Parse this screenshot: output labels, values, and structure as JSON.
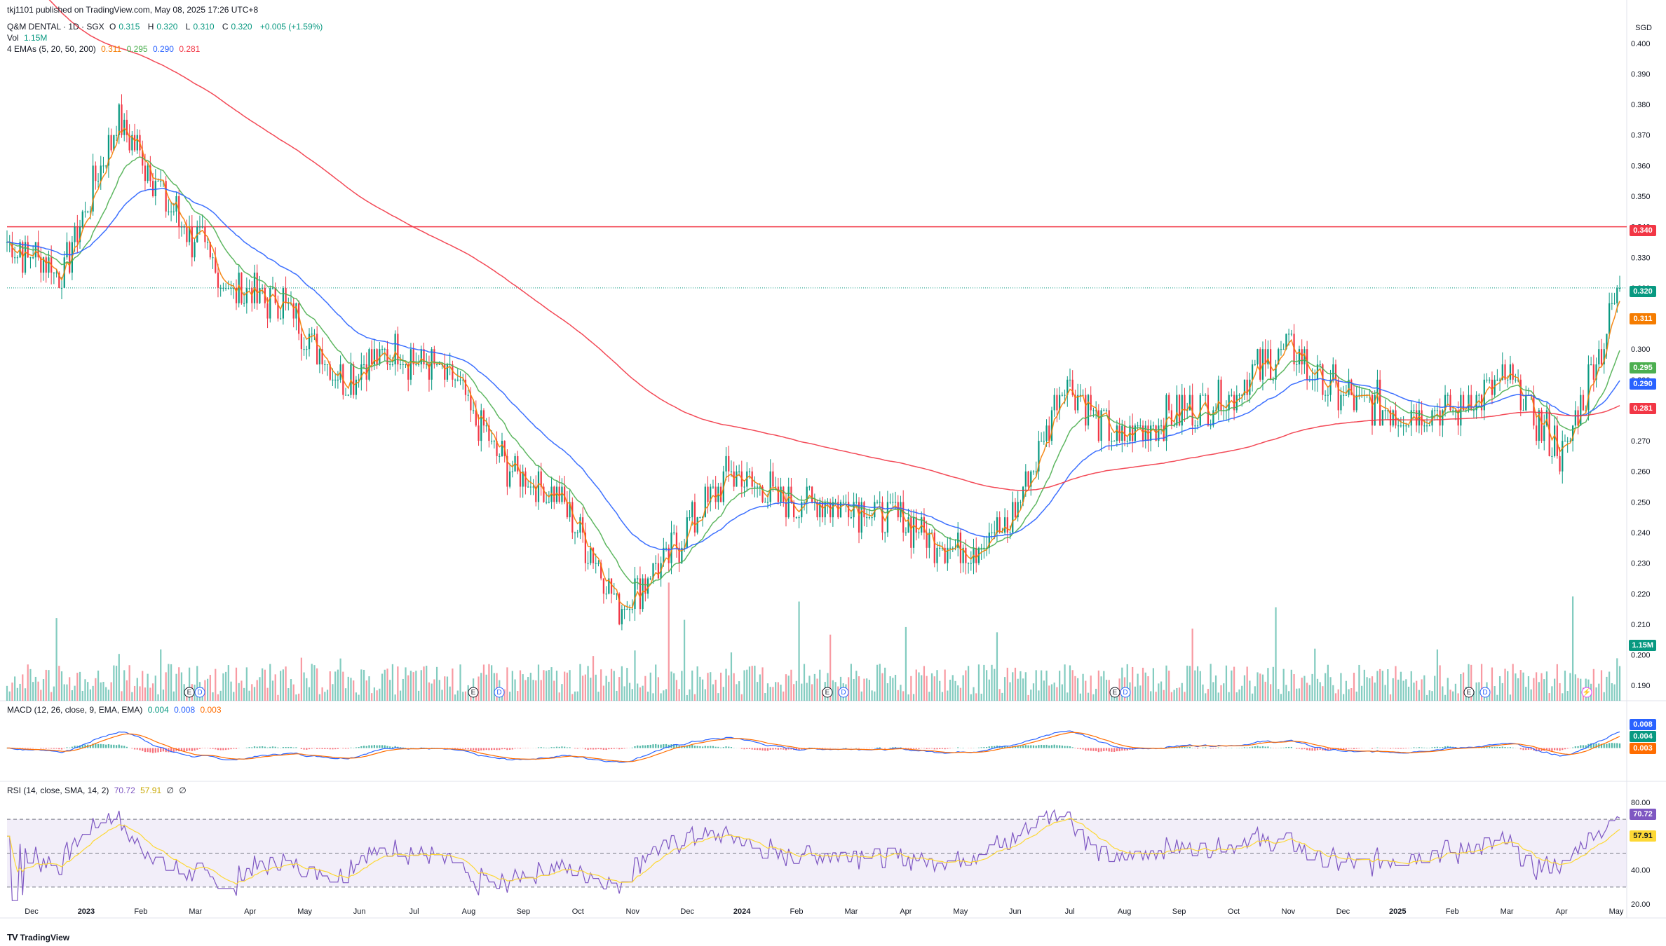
{
  "header": {
    "published": "tkj1101 published on TradingView.com, May 08, 2025 17:26 UTC+8",
    "symbol": "Q&M DENTAL · 1D · SGX",
    "ohlc": {
      "o_label": "O",
      "o": "0.315",
      "h_label": "H",
      "h": "0.320",
      "l_label": "L",
      "l": "0.310",
      "c_label": "C",
      "c": "0.320",
      "change": "+0.005 (+1.59%)"
    },
    "vol_label": "Vol",
    "vol": "1.15M",
    "ema_label": "4 EMAs (5, 20, 50, 200)",
    "ema_values": [
      "0.311",
      "0.295",
      "0.290",
      "0.281"
    ],
    "macd_label": "MACD (12, 26, close, 9, EMA, EMA)",
    "macd_values": [
      "0.004",
      "0.008",
      "0.003"
    ],
    "rsi_label": "RSI (14, close, SMA, 14, 2)",
    "rsi_values": [
      "70.72",
      "57.91",
      "∅",
      "∅"
    ]
  },
  "currency": "SGD",
  "colors": {
    "up": "#089981",
    "down": "#f23645",
    "ema5": "#f57c00",
    "ema20": "#4caf50",
    "ema50": "#2962ff",
    "ema200": "#f23645",
    "hline": "#f23645",
    "macd": "#2962ff",
    "signal": "#ff6d00",
    "rsi": "#7e57c2",
    "rsi_ma": "#fdd835"
  },
  "price_tags": {
    "hline": "0.340",
    "last": "0.320",
    "ema5": "0.311",
    "ema20": "0.295",
    "ema50": "0.290",
    "ema200": "0.281",
    "vol": "1.15M",
    "macd": "0.008",
    "hist": "0.004",
    "signal": "0.003",
    "rsi": "70.72",
    "rsi_ma": "57.91"
  },
  "footer": {
    "brand": "TradingView"
  },
  "events": {
    "earnings": "E",
    "dividend": "D",
    "flash": "⚡"
  },
  "chart_data": {
    "type": "candlestick",
    "title": "Q&M DENTAL · 1D · SGX",
    "x_axis_labels": [
      "Dec",
      "2023",
      "Feb",
      "Mar",
      "Apr",
      "May",
      "Jun",
      "Jul",
      "Aug",
      "Sep",
      "Oct",
      "Nov",
      "Dec",
      "2024",
      "Feb",
      "Mar",
      "Apr",
      "May",
      "Jun",
      "Jul",
      "Aug",
      "Sep",
      "Oct",
      "Nov",
      "Dec",
      "2025",
      "Feb",
      "Mar",
      "Apr",
      "May"
    ],
    "price_axis": {
      "min": 0.185,
      "max": 0.405,
      "ticks": [
        "0.400",
        "0.390",
        "0.380",
        "0.370",
        "0.360",
        "0.350",
        "0.340",
        "0.330",
        "0.320",
        "0.310",
        "0.300",
        "0.290",
        "0.280",
        "0.270",
        "0.260",
        "0.250",
        "0.240",
        "0.230",
        "0.220",
        "0.210",
        "0.200",
        "0.190"
      ]
    },
    "horizontal_line": 0.34,
    "close_approx": {
      "x": [
        "Dec 2022",
        "Jan 2023",
        "Feb 2023",
        "Mar 2023",
        "Apr 2023",
        "May 2023",
        "Jun 2023",
        "Jul 2023",
        "Aug 2023",
        "Sep 2023",
        "Oct 2023",
        "Nov 2023",
        "Dec 2023",
        "Jan 2024",
        "Feb 2024",
        "Mar 2024",
        "Apr 2024",
        "May 2024",
        "Jun 2024",
        "Jul 2024",
        "Aug 2024",
        "Sep 2024",
        "Oct 2024",
        "Nov 2024",
        "Dec 2024",
        "Jan 2025",
        "Feb 2025",
        "Mar 2025",
        "Apr 2025",
        "May 2025"
      ],
      "close": [
        0.335,
        0.325,
        0.375,
        0.345,
        0.32,
        0.315,
        0.29,
        0.3,
        0.29,
        0.26,
        0.25,
        0.215,
        0.235,
        0.26,
        0.25,
        0.25,
        0.245,
        0.235,
        0.24,
        0.29,
        0.27,
        0.28,
        0.285,
        0.3,
        0.285,
        0.28,
        0.28,
        0.29,
        0.265,
        0.32
      ]
    },
    "ema": {
      "names": [
        "EMA 5",
        "EMA 20",
        "EMA 50",
        "EMA 200"
      ],
      "last": [
        0.311,
        0.295,
        0.29,
        0.281
      ]
    },
    "macd": {
      "last_macd": 0.008,
      "last_hist": 0.004,
      "last_signal": 0.003
    },
    "rsi": {
      "ticks": [
        "80.00",
        "40.00",
        "20.00"
      ],
      "last": 70.72,
      "ma_last": 57.91,
      "bands": [
        70,
        30
      ]
    },
    "volume_last": "1.15M"
  }
}
